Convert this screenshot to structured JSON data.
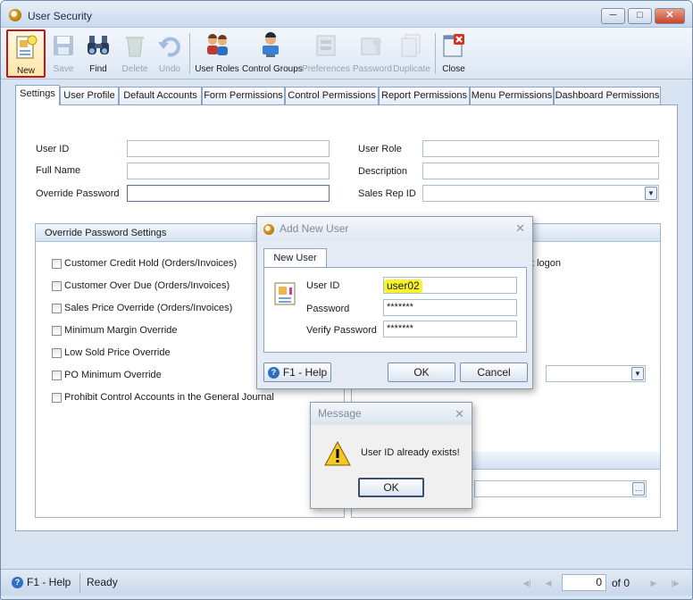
{
  "window": {
    "title": "User Security"
  },
  "toolbar": {
    "new": "New",
    "save": "Save",
    "find": "Find",
    "delete": "Delete",
    "undo": "Undo",
    "user_roles": "User Roles",
    "control_groups": "Control Groups",
    "preferences": "Preferences",
    "password": "Password",
    "duplicate": "Duplicate",
    "close": "Close"
  },
  "tabs": [
    "Settings",
    "User Profile",
    "Default Accounts",
    "Form Permissions",
    "Control Permissions",
    "Report Permissions",
    "Menu Permissions",
    "Dashboard Permissions"
  ],
  "form": {
    "user_id": "User ID",
    "full_name": "Full Name",
    "override_password": "Override Password",
    "user_role": "User Role",
    "description": "Description",
    "sales_rep_id": "Sales Rep ID"
  },
  "override_group": {
    "title": "Override Password Settings",
    "items": [
      "Customer Credit Hold (Orders/Invoices)",
      "Customer Over Due (Orders/Invoices)",
      "Sales Price Override (Orders/Invoices)",
      "Minimum Margin Override",
      "Low Sold Price Override",
      "PO Minimum Override",
      "Prohibit Control Accounts in the General Journal"
    ]
  },
  "right_group": {
    "partial_text": "t logon"
  },
  "add_user_dialog": {
    "title": "Add New User",
    "tab": "New User",
    "user_id_label": "User ID",
    "user_id_value": "user02",
    "password_label": "Password",
    "password_value": "*******",
    "verify_label": "Verify Password",
    "verify_value": "*******",
    "help": "F1 - Help",
    "ok": "OK",
    "cancel": "Cancel"
  },
  "message_dialog": {
    "title": "Message",
    "text": "User ID already exists!",
    "ok": "OK"
  },
  "statusbar": {
    "help": "F1 - Help",
    "status": "Ready",
    "page": "0",
    "of": "of 0"
  },
  "colors": {
    "highlight": "#f8f32c",
    "accent": "#c2161d",
    "frame": "#d9e4f2"
  }
}
